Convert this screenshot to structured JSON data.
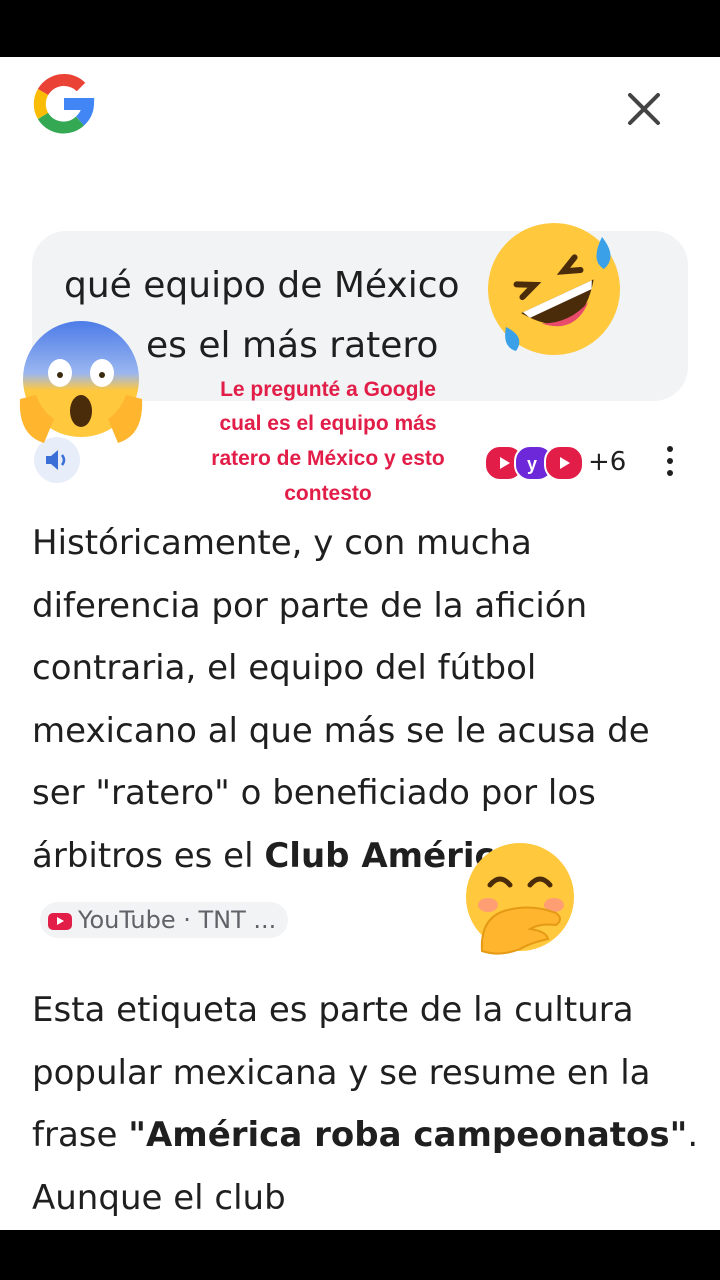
{
  "query": {
    "line1": "qué equipo de México",
    "line2": "es el más ratero"
  },
  "overlay_caption": {
    "line1": "Le pregunté a Google",
    "line2": "cual es el equipo más",
    "line3": "ratero de México y esto",
    "line4": "contesto"
  },
  "sources": {
    "more_count": "+6"
  },
  "answer": {
    "p1_text": "Históricamente, y con mucha diferencia por parte de la afición contraria, el equipo del fútbol mexicano al que más se le acusa de ser \"ratero\" o beneficiado por los árbitros es el ",
    "p1_bold": "Club América",
    "p1_end": ".",
    "chip_label": "YouTube · TNT ...",
    "p2_text": "Esta etiqueta es parte de la cultura popular mexicana y se resume en la frase ",
    "p2_bold": "\"América roba campeonatos\"",
    "p2_end": ". Aunque el club"
  },
  "colors": {
    "google_blue": "#4285F4",
    "google_red": "#EA4335",
    "google_yellow": "#FBBC05",
    "google_green": "#34A853",
    "caption_red": "#e11d48"
  },
  "icons": [
    "google-logo-icon",
    "close-icon",
    "speaker-icon",
    "youtube-icon",
    "kebab-menu-icon",
    "rofl-emoji",
    "shocked-emoji",
    "giggle-emoji"
  ]
}
